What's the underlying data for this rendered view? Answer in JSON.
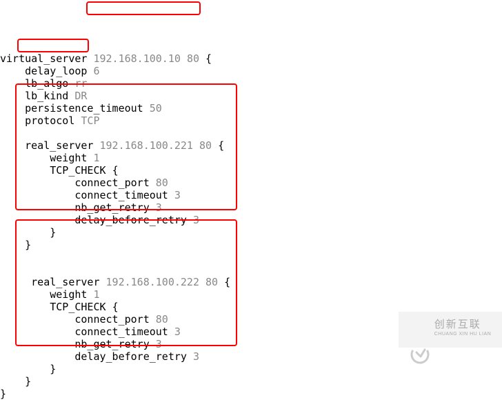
{
  "config": {
    "vs_key": "virtual_server",
    "vs_ip": "192.168.100.10",
    "vs_port": "80",
    "brace_open": "{",
    "brace_close": "}",
    "delay_loop_k": "delay_loop",
    "delay_loop_v": "6",
    "lb_algo_k": "lb_algo",
    "lb_algo_v": "rr",
    "lb_kind_k": "lb_kind",
    "lb_kind_v": "DR",
    "persist_k": "persistence_timeout",
    "persist_v": "50",
    "proto_k": "protocol",
    "proto_v": "TCP",
    "rs_key": "real_server",
    "rs1_ip": "192.168.100.221",
    "rs2_ip": "192.168.100.222",
    "rs_port": "80",
    "weight_k": "weight",
    "weight_v": "1",
    "tcpchk_k": "TCP_CHECK",
    "cport_k": "connect_port",
    "cport_v": "80",
    "ctimeout_k": "connect_timeout",
    "ctimeout_v": "3",
    "nbretry_k": "nb_get_retry",
    "nbretry_v": "3",
    "dbretry_k": "delay_before_retry",
    "dbretry_v": "3"
  },
  "watermark": {
    "line1": "创新互联",
    "line2": "CHUANG XIN HU LIAN"
  }
}
